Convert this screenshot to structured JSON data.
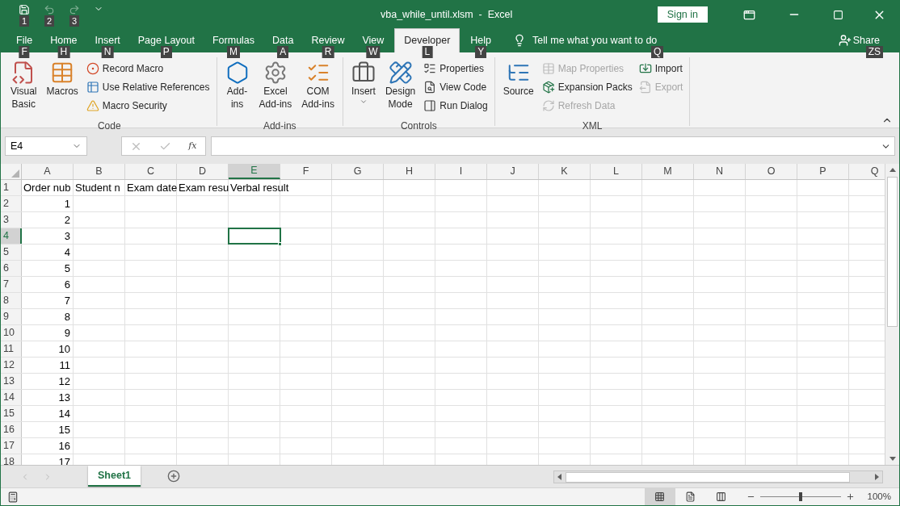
{
  "window": {
    "title": "vba_while_until.xlsm  -  Excel",
    "sign_in": "Sign in",
    "quick_access_keytips": [
      "1",
      "2",
      "3"
    ]
  },
  "tabs": [
    {
      "label": "File",
      "keytip": "F",
      "selected": false
    },
    {
      "label": "Home",
      "keytip": "H",
      "selected": false
    },
    {
      "label": "Insert",
      "keytip": "N",
      "selected": false
    },
    {
      "label": "Page Layout",
      "keytip": "P",
      "selected": false
    },
    {
      "label": "Formulas",
      "keytip": "M",
      "selected": false
    },
    {
      "label": "Data",
      "keytip": "A",
      "selected": false
    },
    {
      "label": "Review",
      "keytip": "R",
      "selected": false
    },
    {
      "label": "View",
      "keytip": "W",
      "selected": false
    },
    {
      "label": "Developer",
      "keytip": "L",
      "selected": true
    },
    {
      "label": "Help",
      "keytip": "Y",
      "selected": false
    }
  ],
  "tell_me": {
    "text": "Tell me what you want to do",
    "keytip": "Q"
  },
  "share": {
    "label": "Share",
    "keytip": "ZS"
  },
  "ribbon": [
    {
      "label": "Code",
      "items": [
        {
          "kind": "large",
          "label_lines": [
            "Visual",
            "Basic"
          ],
          "disabled": false
        },
        {
          "kind": "large",
          "label_lines": [
            "Macros"
          ],
          "disabled": false
        },
        {
          "kind": "small",
          "label": "Record Macro",
          "disabled": false
        },
        {
          "kind": "small",
          "label": "Use Relative References",
          "disabled": false
        },
        {
          "kind": "small",
          "label": "Macro Security",
          "disabled": false
        }
      ]
    },
    {
      "label": "Add-ins",
      "items": [
        {
          "kind": "large",
          "label_lines": [
            "Add-",
            "ins"
          ],
          "disabled": false
        },
        {
          "kind": "large",
          "label_lines": [
            "Excel",
            "Add-ins"
          ],
          "disabled": false
        },
        {
          "kind": "large",
          "label_lines": [
            "COM",
            "Add-ins"
          ],
          "disabled": false
        }
      ]
    },
    {
      "label": "Controls",
      "items": [
        {
          "kind": "large",
          "label_lines": [
            "Insert"
          ],
          "dropdown": true,
          "disabled": false
        },
        {
          "kind": "large",
          "label_lines": [
            "Design",
            "Mode"
          ],
          "disabled": false
        },
        {
          "kind": "small",
          "label": "Properties",
          "disabled": false
        },
        {
          "kind": "small",
          "label": "View Code",
          "disabled": false
        },
        {
          "kind": "small",
          "label": "Run Dialog",
          "disabled": false
        }
      ]
    },
    {
      "label": "XML",
      "items": [
        {
          "kind": "large",
          "label_lines": [
            "Source"
          ],
          "disabled": false
        },
        {
          "kind": "small",
          "label": "Map Properties",
          "disabled": true
        },
        {
          "kind": "small",
          "label": "Expansion Packs",
          "disabled": false
        },
        {
          "kind": "small",
          "label": "Refresh Data",
          "disabled": true
        },
        {
          "kind": "small",
          "label": "Import",
          "disabled": false
        },
        {
          "kind": "small",
          "label": "Export",
          "disabled": true
        }
      ]
    }
  ],
  "formula_bar": {
    "name_box": "E4",
    "function_label": "fx"
  },
  "grid": {
    "columns": [
      {
        "label": "A",
        "selected": false
      },
      {
        "label": "B",
        "selected": false
      },
      {
        "label": "C",
        "selected": false
      },
      {
        "label": "D",
        "selected": false
      },
      {
        "label": "E",
        "selected": true
      },
      {
        "label": "F",
        "selected": false
      },
      {
        "label": "G",
        "selected": false
      },
      {
        "label": "H",
        "selected": false
      },
      {
        "label": "I",
        "selected": false
      },
      {
        "label": "J",
        "selected": false
      },
      {
        "label": "K",
        "selected": false
      },
      {
        "label": "L",
        "selected": false
      },
      {
        "label": "M",
        "selected": false
      },
      {
        "label": "N",
        "selected": false
      },
      {
        "label": "O",
        "selected": false
      },
      {
        "label": "P",
        "selected": false
      },
      {
        "label": "Q",
        "selected": false
      }
    ],
    "rows": [
      {
        "header": "1",
        "selected": false,
        "cells": [
          {
            "text": "Order nub",
            "kind": "text"
          },
          {
            "text": "Student n",
            "kind": "text"
          },
          {
            "text": "Exam date",
            "kind": "text"
          },
          {
            "text": "Exam resu",
            "kind": "text"
          },
          {
            "text": "Verbal result",
            "kind": "text"
          }
        ]
      },
      {
        "header": "2",
        "selected": false,
        "cells": [
          {
            "text": "1",
            "kind": "number"
          }
        ]
      },
      {
        "header": "3",
        "selected": false,
        "cells": [
          {
            "text": "2",
            "kind": "number"
          }
        ]
      },
      {
        "header": "4",
        "selected": true,
        "cells": [
          {
            "text": "3",
            "kind": "number"
          }
        ]
      },
      {
        "header": "5",
        "selected": false,
        "cells": [
          {
            "text": "4",
            "kind": "number"
          }
        ]
      },
      {
        "header": "6",
        "selected": false,
        "cells": [
          {
            "text": "5",
            "kind": "number"
          }
        ]
      },
      {
        "header": "7",
        "selected": false,
        "cells": [
          {
            "text": "6",
            "kind": "number"
          }
        ]
      },
      {
        "header": "8",
        "selected": false,
        "cells": [
          {
            "text": "7",
            "kind": "number"
          }
        ]
      },
      {
        "header": "9",
        "selected": false,
        "cells": [
          {
            "text": "8",
            "kind": "number"
          }
        ]
      },
      {
        "header": "10",
        "selected": false,
        "cells": [
          {
            "text": "9",
            "kind": "number"
          }
        ]
      },
      {
        "header": "11",
        "selected": false,
        "cells": [
          {
            "text": "10",
            "kind": "number"
          }
        ]
      },
      {
        "header": "12",
        "selected": false,
        "cells": [
          {
            "text": "11",
            "kind": "number"
          }
        ]
      },
      {
        "header": "13",
        "selected": false,
        "cells": [
          {
            "text": "12",
            "kind": "number"
          }
        ]
      },
      {
        "header": "14",
        "selected": false,
        "cells": [
          {
            "text": "13",
            "kind": "number"
          }
        ]
      },
      {
        "header": "15",
        "selected": false,
        "cells": [
          {
            "text": "14",
            "kind": "number"
          }
        ]
      },
      {
        "header": "16",
        "selected": false,
        "cells": [
          {
            "text": "15",
            "kind": "number"
          }
        ]
      },
      {
        "header": "17",
        "selected": false,
        "cells": [
          {
            "text": "16",
            "kind": "number"
          }
        ]
      },
      {
        "header": "18",
        "selected": false,
        "cells": [
          {
            "text": "17",
            "kind": "number"
          }
        ]
      }
    ]
  },
  "sheets": [
    {
      "label": "Sheet1",
      "selected": true
    }
  ],
  "status_bar": {
    "views": [
      {
        "selected": true
      },
      {
        "selected": false
      },
      {
        "selected": false
      }
    ],
    "zoom": {
      "level": 0.5,
      "reading": "100%"
    }
  }
}
